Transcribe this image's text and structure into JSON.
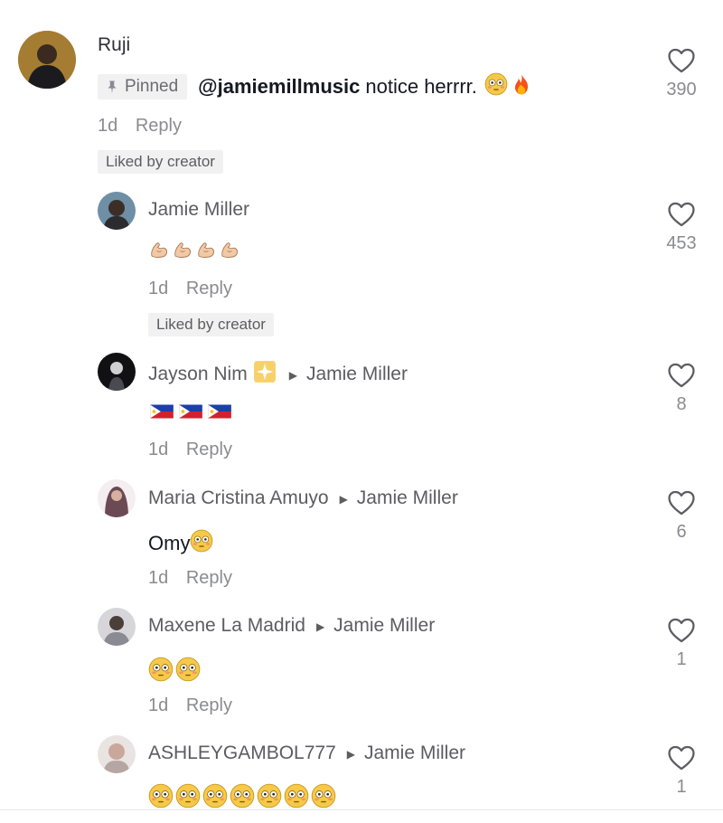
{
  "comments": [
    {
      "author": "Ruji",
      "pinned_label": "Pinned",
      "mention": "@jamiemillmusic",
      "text": "notice herrrr.",
      "emojis": [
        "flushed",
        "fire"
      ],
      "age": "1d",
      "reply_label": "Reply",
      "liked_label": "Liked by creator",
      "likes": "390"
    },
    {
      "author": "Jamie Miller",
      "emojis": [
        "muscle",
        "muscle",
        "muscle",
        "muscle"
      ],
      "age": "1d",
      "reply_label": "Reply",
      "liked_label": "Liked by creator",
      "likes": "453"
    },
    {
      "author": "Jayson Nim",
      "author_badge": "sparkle-icon",
      "reply_to": "Jamie Miller",
      "emojis": [
        "flag-philippines",
        "flag-philippines",
        "flag-philippines"
      ],
      "age": "1d",
      "reply_label": "Reply",
      "likes": "8"
    },
    {
      "author": "Maria Cristina Amuyo",
      "reply_to": "Jamie Miller",
      "text": "Omy",
      "emojis": [
        "flushed"
      ],
      "age": "1d",
      "reply_label": "Reply",
      "likes": "6"
    },
    {
      "author": "Maxene La Madrid",
      "reply_to": "Jamie Miller",
      "emojis": [
        "flushed",
        "flushed"
      ],
      "age": "1d",
      "reply_label": "Reply",
      "likes": "1"
    },
    {
      "author": "ASHLEYGAMBOL777",
      "reply_to": "Jamie Miller",
      "emojis": [
        "flushed",
        "flushed",
        "flushed",
        "flushed",
        "flushed",
        "flushed",
        "flushed"
      ],
      "likes": "1"
    }
  ],
  "colors": {
    "text_primary": "#161823",
    "text_secondary": "#8a8b91",
    "badge_bg": "#f1f1f2"
  }
}
